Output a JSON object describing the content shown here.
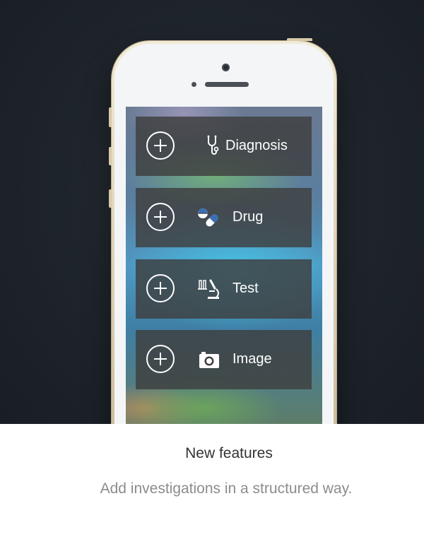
{
  "menu": {
    "items": [
      {
        "label": "Diagnosis",
        "icon": "stethoscope-icon",
        "add_icon": "add-circle-icon"
      },
      {
        "label": "Drug",
        "icon": "pill-icon",
        "add_icon": "add-circle-icon"
      },
      {
        "label": "Test",
        "icon": "microscope-icon",
        "add_icon": "add-circle-icon"
      },
      {
        "label": "Image",
        "icon": "camera-icon",
        "add_icon": "add-circle-icon"
      }
    ]
  },
  "caption": {
    "title": "New features",
    "subtitle": "Add investigations in a structured way."
  },
  "colors": {
    "menu_item_bg": "#3e3e3e",
    "pill_accent": "#3b6fb5",
    "hero_bg": "#1f252c"
  }
}
